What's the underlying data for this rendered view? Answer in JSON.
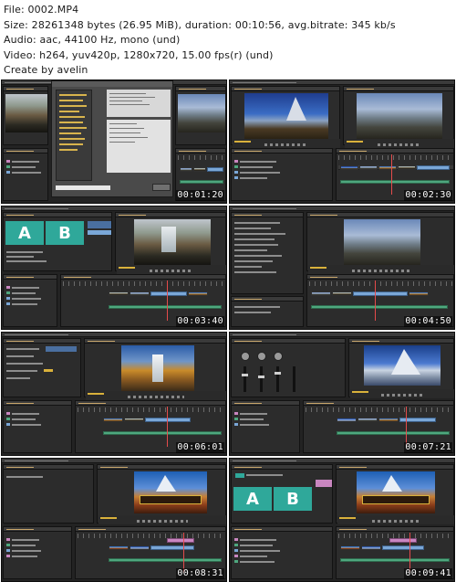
{
  "file_info": {
    "file": "File: 0002.MP4",
    "size": "Size: 28261348 bytes (26.95 MiB), duration: 00:10:56, avg.bitrate: 345 kb/s",
    "audio": "Audio: aac, 44100 Hz, mono (und)",
    "video": "Video: h264, yuv420p, 1280x720, 15.00 fps(r) (und)",
    "credit": "Create by avelin"
  },
  "thumbnails": [
    {
      "timestamp": "00:01:20"
    },
    {
      "timestamp": "00:02:30"
    },
    {
      "timestamp": "00:03:40"
    },
    {
      "timestamp": "00:04:50"
    },
    {
      "timestamp": "00:06:01"
    },
    {
      "timestamp": "00:07:21"
    },
    {
      "timestamp": "00:08:31"
    },
    {
      "timestamp": "00:09:41"
    }
  ],
  "overlays": {
    "letter_a": "A",
    "letter_b": "B"
  },
  "colors": {
    "ui_background": "#232323",
    "panel": "#2c2c2c",
    "clip_video": "#7aa7d7",
    "clip_audio": "#4ea77e",
    "clip_title": "#c986c0",
    "playhead": "#e54b4b",
    "accent_timecode": "#d9b13b",
    "transition_teal": "#2fa89a"
  },
  "icons": [
    "play-icon",
    "folder-icon",
    "video-clip-icon",
    "audio-clip-icon"
  ]
}
